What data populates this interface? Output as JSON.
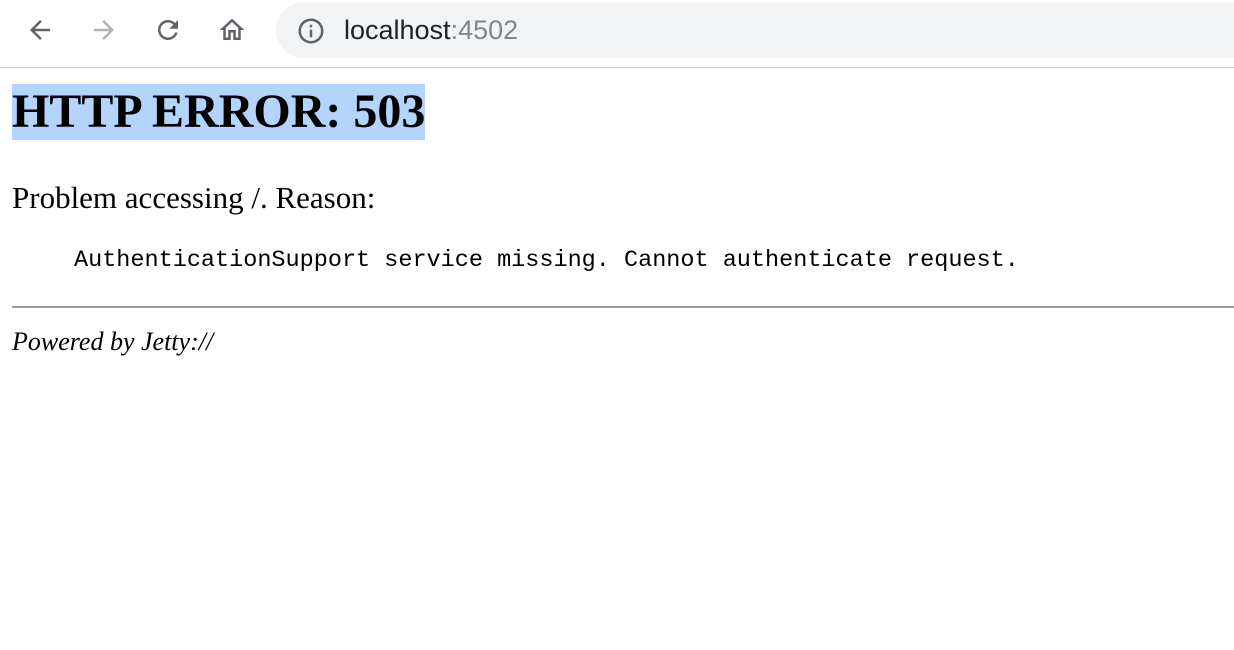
{
  "browser": {
    "url_host": "localhost",
    "url_port": ":4502",
    "icons": {
      "back": "arrow-left-icon",
      "forward": "arrow-right-icon",
      "reload": "reload-icon",
      "home": "home-icon",
      "info": "info-icon"
    }
  },
  "page": {
    "title": "HTTP ERROR: 503",
    "problem": "Problem accessing /. Reason:",
    "reason": "AuthenticationSupport service missing. Cannot authenticate request.",
    "powered_by": "Powered by Jetty://"
  },
  "colors": {
    "selection": "#b3d4fd",
    "omnibox_bg": "#f1f3f4"
  }
}
